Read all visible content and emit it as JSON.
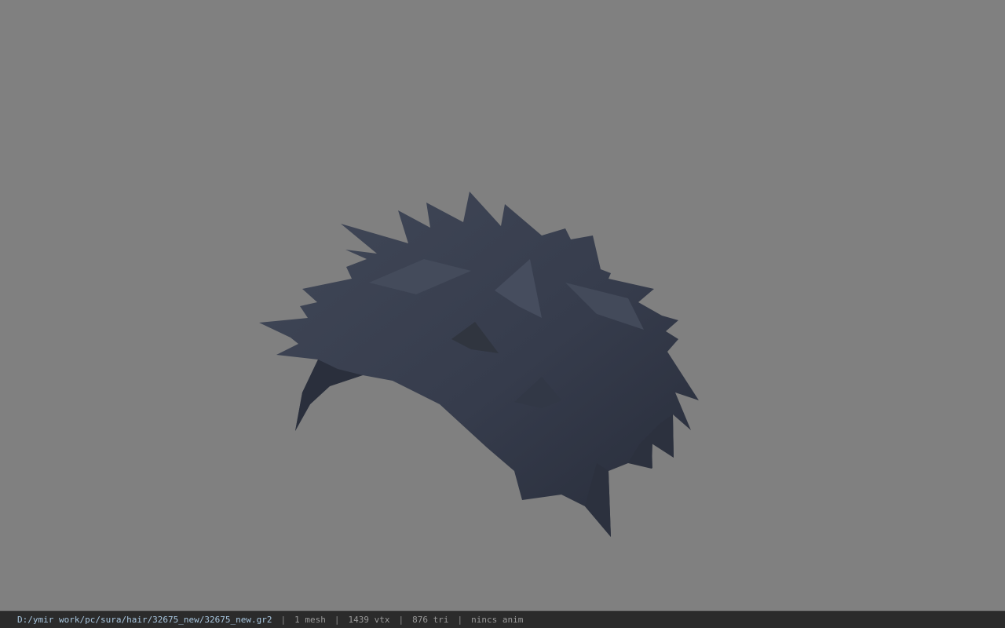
{
  "viewport": {
    "background_color": "#808080",
    "model": {
      "name": "hair-mesh",
      "color": "#3a4050"
    }
  },
  "status_bar": {
    "file_path": "D:/ymir work/pc/sura/hair/32675_new/32675_new.gr2",
    "mesh_count": "1 mesh",
    "vertex_count": "1439 vtx",
    "triangle_count": "876 tri",
    "anim_status": "nincs anim",
    "separator": "|"
  }
}
